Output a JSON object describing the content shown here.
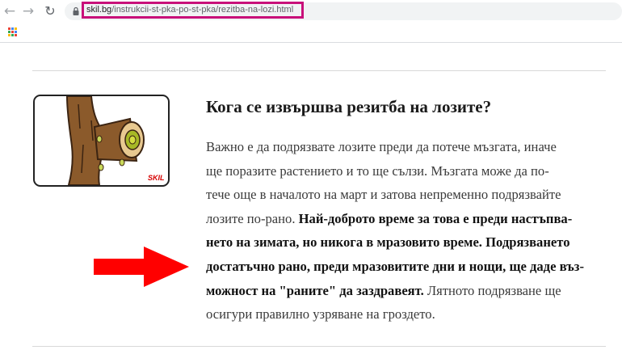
{
  "browser": {
    "url_host": "skil.bg",
    "url_path": "/instrukcii-st-pka-po-st-pka/rezitba-na-lozi.html",
    "highlight_color": "#c8107a"
  },
  "illustration": {
    "logo_text": "SKIL"
  },
  "article": {
    "heading": "Кога се извършва резитба на лозите?",
    "lines": [
      {
        "normal": "Важно е да подрязвате лозите преди да потече мъзгата, иначе",
        "bold": "",
        "tail": ""
      },
      {
        "normal": "ще поразите растението и то ще сълзи. Мъзгата може да по-",
        "bold": "",
        "tail": ""
      },
      {
        "normal": "тече още в началото на март и затова непременно подрязвайте",
        "bold": "",
        "tail": ""
      },
      {
        "normal": "лозите по-рано. ",
        "bold": "Най-доброто време за това е преди настъпва-",
        "tail": ""
      },
      {
        "normal": "",
        "bold": "нето на зимата, но никога в мразовито време. Подрязването",
        "tail": ""
      },
      {
        "normal": "",
        "bold": "достатъчно рано, преди мразовитите дни и нощи, ще даде въз-",
        "tail": ""
      },
      {
        "normal": "",
        "bold": "можност на \"раните\" да заздравеят.",
        "tail": " Лятното подрязване ще"
      },
      {
        "normal": "осигури правилно узряване на гроздето.",
        "bold": "",
        "tail": ""
      }
    ]
  },
  "colors": {
    "arrow": "#ff0000",
    "trunk": "#8b5a2b"
  },
  "icons": [
    "back-arrow-icon",
    "forward-arrow-icon",
    "reload-icon",
    "lock-icon",
    "apps-grid-icon",
    "red-arrow-icon"
  ]
}
